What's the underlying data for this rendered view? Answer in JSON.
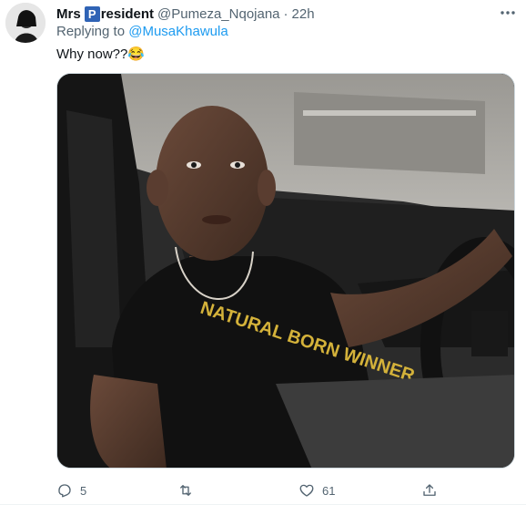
{
  "tweet": {
    "display_name_part1": "Mrs",
    "display_name_badge": "P",
    "display_name_part2": "resident",
    "handle": "@Pumeza_Nqojana",
    "separator": "·",
    "time": "22h",
    "replying_prefix": "Replying to",
    "replying_to": "@MusaKhawula",
    "text": "Why now??😂",
    "media_shirt_text": "NATURAL BORN WINNER"
  },
  "actions": {
    "reply_count": "5",
    "retweet_count": "",
    "like_count": "61",
    "share_count": ""
  },
  "icons": {
    "more": "more-horizontal-icon",
    "reply": "reply-icon",
    "retweet": "retweet-icon",
    "like": "heart-icon",
    "share": "share-icon"
  },
  "colors": {
    "text_primary": "#0f1419",
    "text_secondary": "#536471",
    "link": "#1d9bf0"
  }
}
